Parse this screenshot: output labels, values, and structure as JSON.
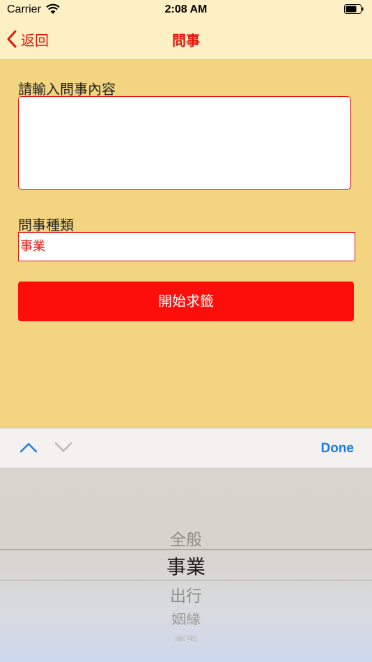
{
  "status_bar": {
    "carrier": "Carrier",
    "time": "2:08 AM"
  },
  "nav": {
    "back_label": "返回",
    "title": "問事"
  },
  "form": {
    "question_label": "請輸入問事內容",
    "question_value": "",
    "category_label": "問事種類",
    "category_value": "事業",
    "start_button": "開始求籤"
  },
  "toolbar": {
    "done_label": "Done"
  },
  "picker": {
    "items": [
      "全般",
      "事業",
      "出行",
      "姻緣",
      "家宅"
    ],
    "selected_index": 1
  },
  "colors": {
    "accent": "#e8130c",
    "button": "#fe0e0a",
    "background": "#f2d481",
    "bar": "#fdf0c4",
    "link": "#1a7cf0"
  }
}
